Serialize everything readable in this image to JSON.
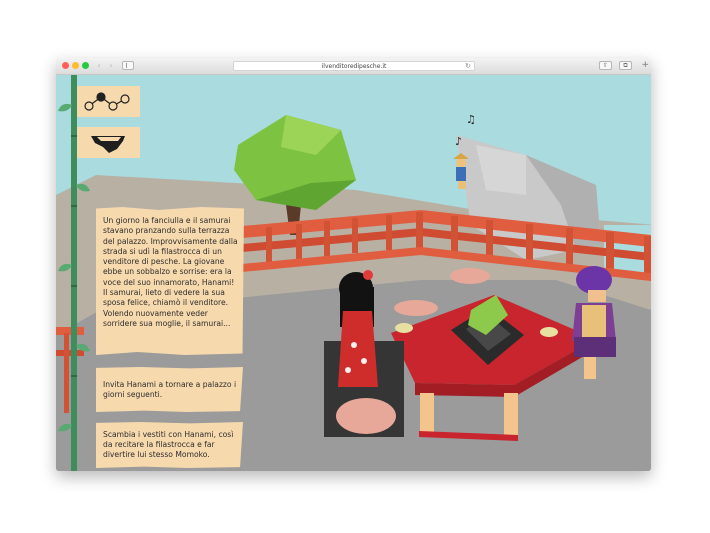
{
  "browser": {
    "url": "ilvenditoredipesche.it",
    "reload_glyph": "↻",
    "back_glyph": "‹",
    "forward_glyph": "›",
    "share_glyph": "⇧",
    "tabs_glyph": "⧉",
    "new_tab_glyph": "+"
  },
  "game": {
    "story_text": "Un giorno la fanciulla e il samurai stavano pranzando sulla terrazza del palazzo. Improvvisamente dalla strada si udì la filastrocca di un venditore di pesche. La giovane ebbe un sobbalzo e sorrise: era la voce del suo innamorato, Hanami! Il samurai, lieto di vedere la sua sposa felice, chiamò il venditore. Volendo nuovamente veder sorridere sua moglie, il samurai...",
    "choices": [
      {
        "label": "Invita Hanami a tornare a palazzo i giorni seguenti."
      },
      {
        "label": "Scambia i vestiti con Hanami, così da recitare la filastrocca e far divertire lui stesso Momoko."
      }
    ],
    "icons": [
      "story-map-icon",
      "shield-icon"
    ]
  },
  "colors": {
    "sky": "#a9dbdf",
    "panel": "#f7d9ae",
    "railing": "#e05d3f",
    "table": "#c8252e",
    "floor": "#9a9b9a",
    "bamboo": "#3f8d5c"
  }
}
